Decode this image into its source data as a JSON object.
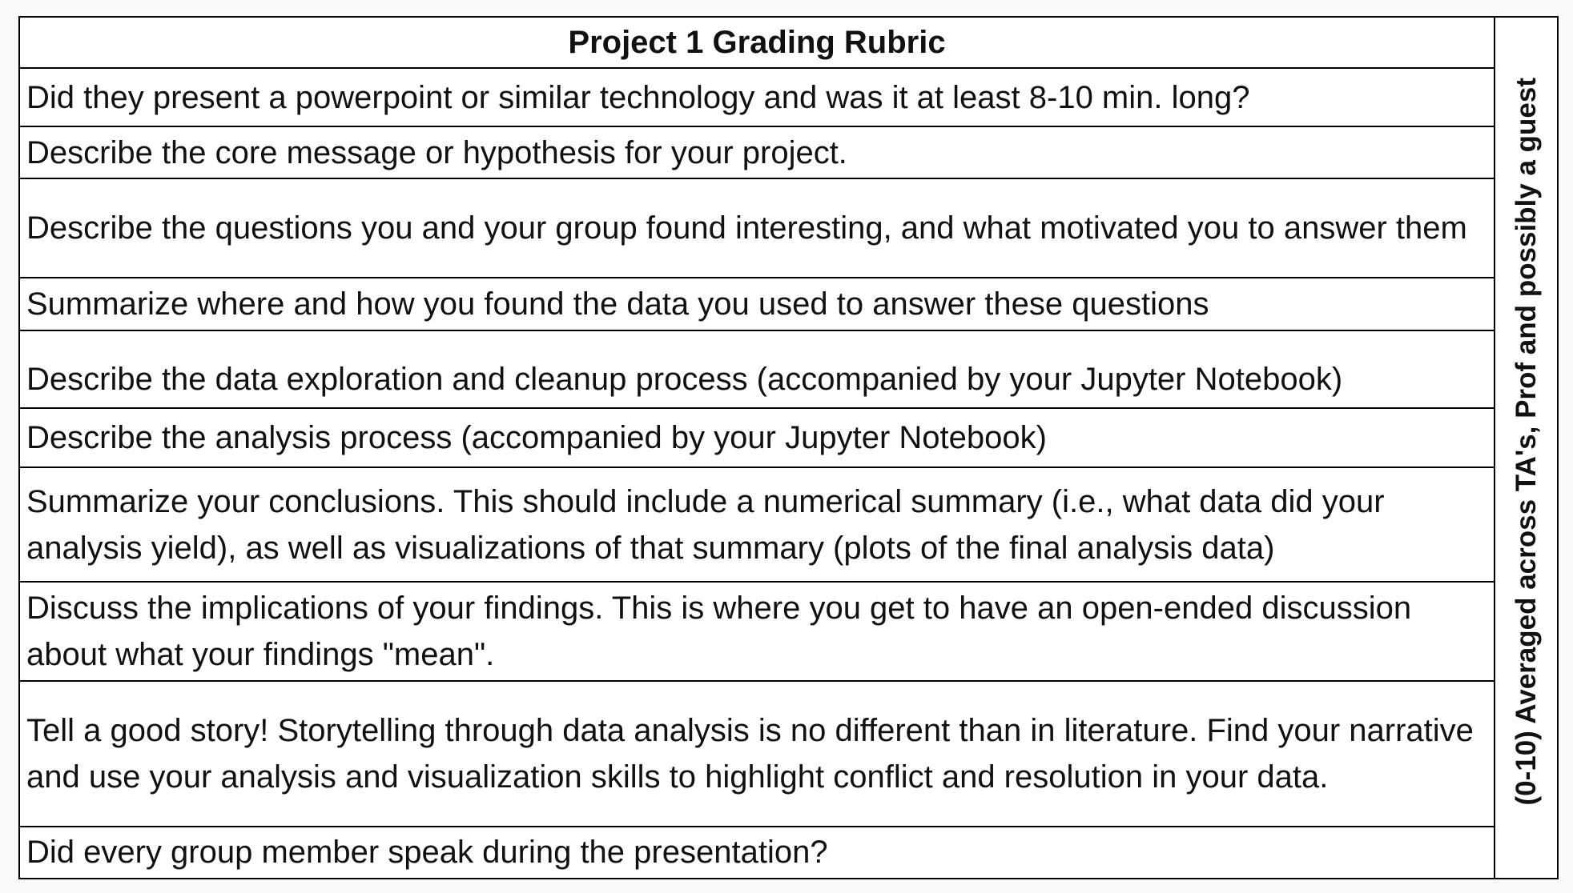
{
  "rubric": {
    "title": "Project 1 Grading Rubric",
    "scoring_note": "(0-10) Averaged across TA's, Prof and possibly a guest",
    "criteria": [
      "Did they present a powerpoint or similar technology and was it at least 8-10 min. long?",
      "Describe the core message or hypothesis for your project.",
      "Describe the questions you and your group found interesting, and what motivated you to answer them",
      "Summarize where and how you found the data you used to answer these questions",
      "Describe the data exploration and cleanup process (accompanied by your Jupyter Notebook)",
      "Describe the analysis process (accompanied by your Jupyter Notebook)",
      "Summarize your conclusions. This should include a numerical summary (i.e., what data did your analysis yield), as well as visualizations of that summary (plots of the final analysis data)",
      "Discuss the implications of your findings. This is where you get to have an open-ended discussion about what your findings \"mean\".",
      "Tell a good story! Storytelling through data analysis is no different than in literature. Find your narrative and use your analysis and visualization skills to highlight conflict and resolution in your data.",
      "Did every group member speak during the presentation?"
    ]
  }
}
